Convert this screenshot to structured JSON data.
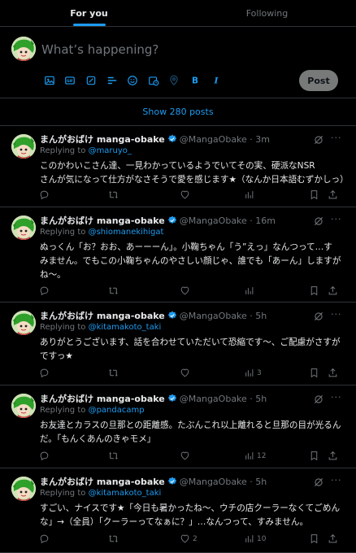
{
  "tabs": {
    "for_you": "For you",
    "following": "Following"
  },
  "composer": {
    "placeholder": "What’s happening?",
    "post_label": "Post",
    "tool_icons": [
      "image-icon",
      "gif-icon",
      "grok-icon",
      "poll-icon",
      "emoji-icon",
      "schedule-icon",
      "location-icon",
      "bold-icon",
      "italic-icon"
    ]
  },
  "show_posts": "Show 280 posts",
  "colors": {
    "accent": "#1d9bf0",
    "muted": "#71767b",
    "border": "#2f3336",
    "background": "#000000"
  },
  "tweets": [
    {
      "name": "まんがおばけ manga-obake",
      "meta": "@MangaObake · 3m",
      "replying_prefix": "Replying to ",
      "replying_handle": "@maruyo_",
      "lines": [
        "このかわいこさん達、一見わかっているようでいてその実、硬派なNSR",
        "さんが気になって仕方がなさそうで愛を感じます★（なんか日本語むずかしっ）"
      ],
      "likes": "",
      "views": ""
    },
    {
      "name": "まんがおばけ manga-obake",
      "meta": "@MangaObake · 16m",
      "replying_prefix": "Replying to ",
      "replying_handle": "@shiomanekihigat",
      "lines": [
        "ぬっくん「お？おお、あーーーん」。小鞠ちゃん「う”えっ」なんつって…す",
        "みません。でもこの小鞠ちゃんのやさしい顔じゃ、誰でも「あーん」しますが",
        "ね〜。"
      ],
      "likes": "",
      "views": ""
    },
    {
      "name": "まんがおばけ manga-obake",
      "meta": "@MangaObake · 5h",
      "replying_prefix": "Replying to ",
      "replying_handle": "@kitamakoto_taki",
      "lines": [
        "ありがとうございます、話を合わせていただいて恐縮です〜、ご配慮がさすが",
        "ですっ★"
      ],
      "likes": "",
      "views": "3"
    },
    {
      "name": "まんがおばけ manga-obake",
      "meta": "@MangaObake · 5h",
      "replying_prefix": "Replying to ",
      "replying_handle": "@pandacamp",
      "lines": [
        "お友達とカラスの旦那との距離感。たぶんこれ以上離れると旦那の目が光るん",
        "だ。「もんくあんのきゃモメ」"
      ],
      "likes": "",
      "views": "12"
    },
    {
      "name": "まんがおばけ manga-obake",
      "meta": "@MangaObake · 5h",
      "replying_prefix": "Replying to ",
      "replying_handle": "@kitamakoto_taki",
      "lines": [
        "すごい、ナイスです★「今日も暑かったね〜、ウチの店クーラーなくてごめん",
        "な」→（全員）「クーラーってなぁに？」…なんつって、すみません。"
      ],
      "likes": "2",
      "views": "10"
    }
  ]
}
